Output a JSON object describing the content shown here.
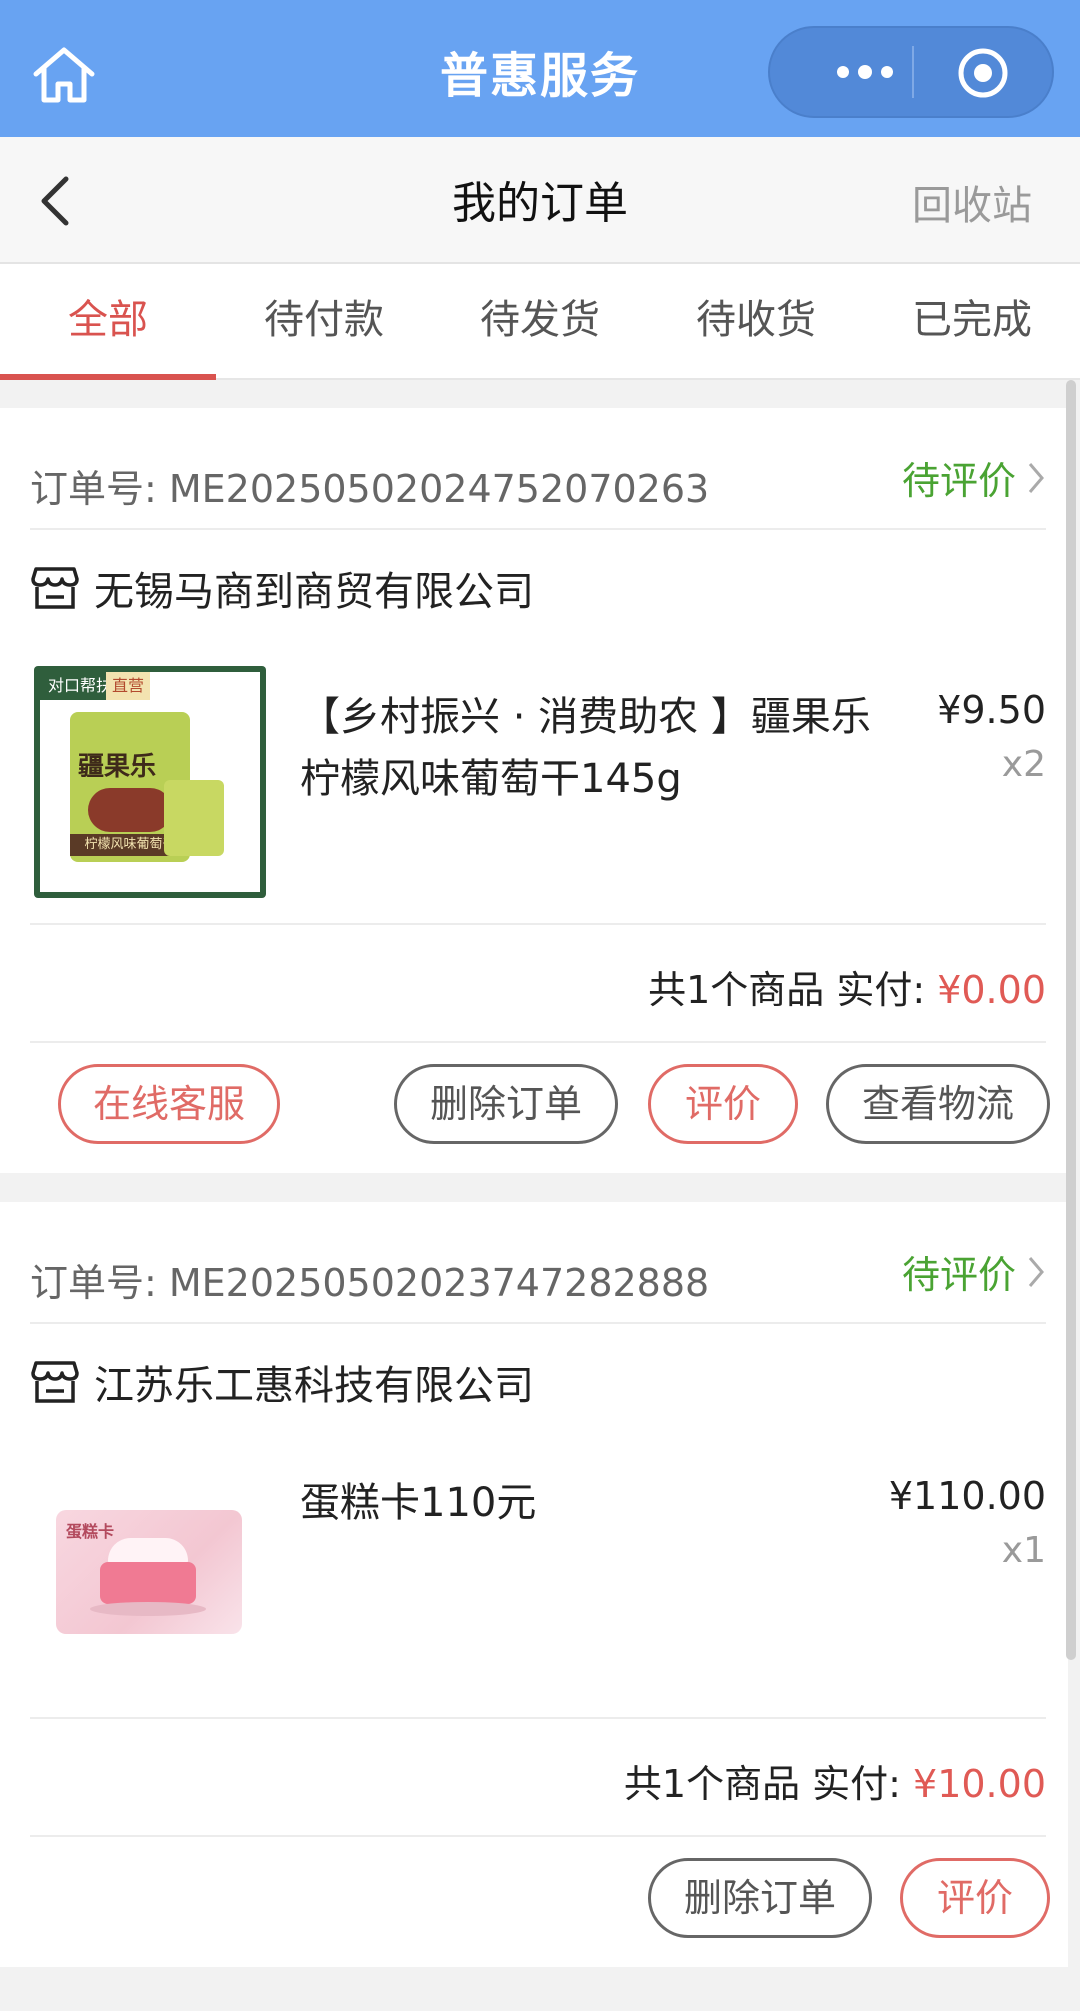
{
  "appbar": {
    "title": "普惠服务"
  },
  "header": {
    "title": "我的订单",
    "recycle_label": "回收站"
  },
  "tabs": [
    {
      "label": "全部",
      "active": true
    },
    {
      "label": "待付款",
      "active": false
    },
    {
      "label": "待发货",
      "active": false
    },
    {
      "label": "待收货",
      "active": false
    },
    {
      "label": "已完成",
      "active": false
    }
  ],
  "orders": [
    {
      "order_no": "订单号: ME2025050202475207026​3",
      "status": "待评价",
      "shop": "无锡马商到商贸有限公司",
      "product": {
        "name": "【乡村振兴 · 消费助农 】疆果乐柠檬风味葡萄干145g",
        "price": "¥9.50",
        "qty": "x2",
        "badge_left": "对口帮扶",
        "badge_right": "直营",
        "pkg_brand": "疆果乐",
        "pkg_flavor": "柠檬风味葡萄干"
      },
      "summary_prefix": "共1个商品 实付: ",
      "summary_amount": "¥0.00",
      "buttons": {
        "service": "在线客服",
        "delete": "删除订单",
        "review": "评价",
        "logistics": "查看物流"
      }
    },
    {
      "order_no": "订单号: ME2025050202374728288​8",
      "status": "待评价",
      "shop": "江苏乐工惠科技有限公司",
      "product": {
        "name": "蛋糕卡110元",
        "price": "¥110.00",
        "qty": "x1",
        "card_label": "蛋糕卡"
      },
      "summary_prefix": "共1个商品 实付: ",
      "summary_amount": "¥10.00",
      "buttons": {
        "delete": "删除订单",
        "review": "评价"
      }
    }
  ],
  "colors": {
    "brand_blue": "#68a3f2",
    "accent_red": "#d9534f",
    "status_green": "#4aa333"
  }
}
